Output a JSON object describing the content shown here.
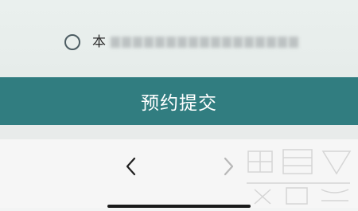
{
  "consent": {
    "label": "本"
  },
  "submit": {
    "label": "预约提交"
  },
  "nav": {
    "back_icon": "chevron-left-icon",
    "forward_icon": "chevron-right-icon"
  },
  "colors": {
    "primary": "#317d80",
    "radio_border": "#4d5d63",
    "background": "#f3f4f4"
  }
}
